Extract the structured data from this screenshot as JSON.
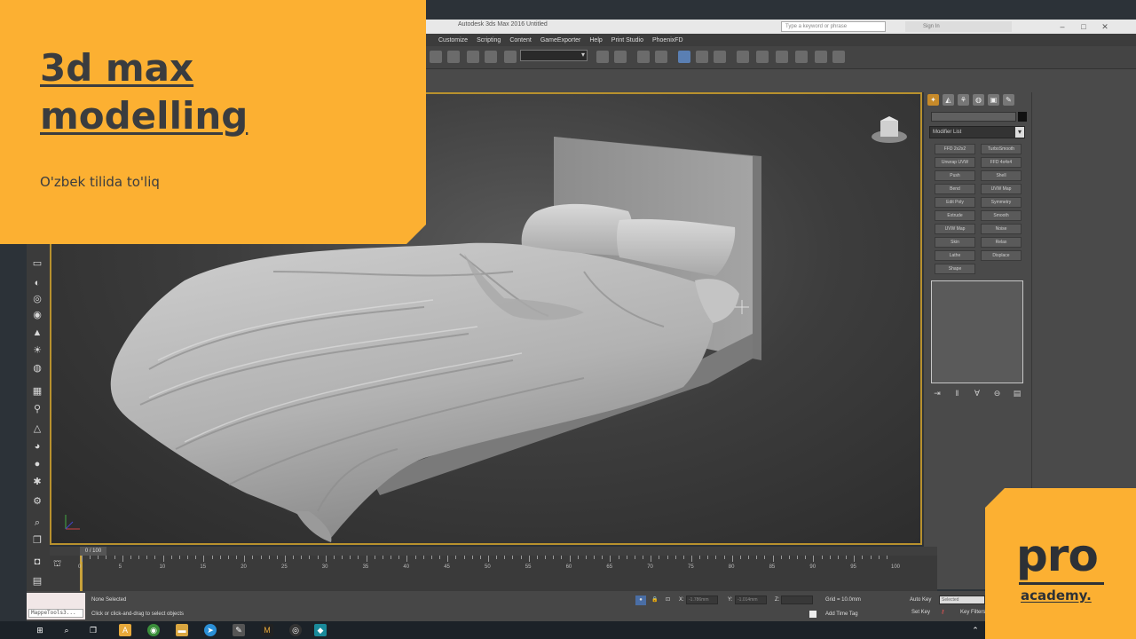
{
  "overlay": {
    "title_line1": "3d max",
    "title_line2": "modelling",
    "subtitle": "O'zbek tilida to'liq",
    "logo_main": "pro",
    "logo_sub": "academy."
  },
  "window": {
    "title": "Autodesk 3ds Max 2016   Untitled",
    "search_placeholder": "Type a keyword or phrase",
    "sign_in": "Sign In"
  },
  "menu": [
    "Customize",
    "Scripting",
    "Content",
    "GameExporter",
    "Help",
    "Print Studio",
    "PhoenixFD"
  ],
  "command_panel": {
    "modifier_list": "Modifier List",
    "buttons": [
      "FFD 2x2x2",
      "TurboSmooth",
      "Unwrap UVW",
      "FFD 4x4x4",
      "Push",
      "Shell",
      "Bend",
      "UVW Map",
      "Edit Poly",
      "Symmetry",
      "Extrude",
      "Smooth",
      "UVW Map",
      "Noise",
      "Skin",
      "Relax",
      "Lathe",
      "Displace",
      "Shape"
    ]
  },
  "timeline": {
    "frame_counter": "0 / 100",
    "ticks": [
      "0",
      "5",
      "10",
      "15",
      "20",
      "25",
      "30",
      "35",
      "40",
      "45",
      "50",
      "55",
      "60",
      "65",
      "70",
      "75",
      "80",
      "85",
      "90",
      "95",
      "100"
    ]
  },
  "status": {
    "selection": "None Selected",
    "prompt": "Click or click-and-drag to select objects",
    "maxscript": "MappeTools3...",
    "x_label": "X:",
    "y_label": "Y:",
    "z_label": "Z:",
    "x_value": "-1.786mm",
    "y_value": "-1.014mm",
    "grid": "Grid = 10.0mm",
    "add_time_tag": "Add Time Tag",
    "auto_key": "Auto Key",
    "auto_key_value": "Selected",
    "set_key": "Set Key",
    "key_filters": "Key Filters..."
  }
}
